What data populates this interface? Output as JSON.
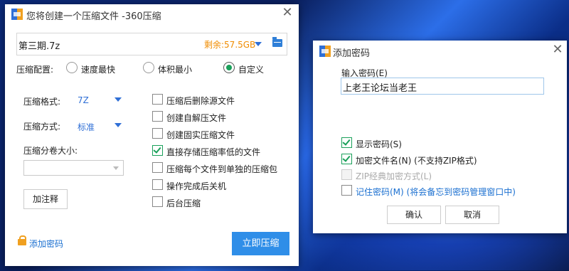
{
  "main_dialog": {
    "title": "您将创建一个压缩文件 -360压缩",
    "filename": "第三期.7z",
    "free_space": "剩余:57.5GB",
    "config_label": "压缩配置:",
    "presets": [
      {
        "label": "速度最快",
        "selected": false
      },
      {
        "label": "体积最小",
        "selected": false
      },
      {
        "label": "自定义",
        "selected": true
      }
    ],
    "format_label": "压缩格式:",
    "format_value": "7Z",
    "method_label": "压缩方式:",
    "method_value": "标准",
    "split_label": "压缩分卷大小:",
    "split_value": "",
    "comment_button": "加注释",
    "options": [
      {
        "label": "压缩后删除源文件",
        "checked": false
      },
      {
        "label": "创建自解压文件",
        "checked": false
      },
      {
        "label": "创建固实压缩文件",
        "checked": false
      },
      {
        "label": "直接存储压缩率低的文件",
        "checked": true
      },
      {
        "label": "压缩每个文件到单独的压缩包",
        "checked": false
      },
      {
        "label": "操作完成后关机",
        "checked": false
      },
      {
        "label": "后台压缩",
        "checked": false
      }
    ],
    "add_password_link": "添加密码",
    "compress_button": "立即压缩"
  },
  "password_dialog": {
    "title": "添加密码",
    "input_label": "输入密码(E)",
    "password_value": "上老王论坛当老王",
    "options": [
      {
        "label": "显示密码(S)",
        "checked": true,
        "disabled": false
      },
      {
        "label": "加密文件名(N) (不支持ZIP格式)",
        "checked": true,
        "disabled": false
      },
      {
        "label": "ZIP经典加密方式(L)",
        "checked": false,
        "disabled": true
      },
      {
        "label": "记住密码(M) (将会备忘到密码管理窗口中)",
        "checked": false,
        "disabled": false
      }
    ],
    "ok_button": "确认",
    "cancel_button": "取消"
  },
  "colors": {
    "accent": "#2f8ee8",
    "orange": "#f08c00",
    "green": "#1aa05a",
    "link": "#1a6fd0"
  }
}
